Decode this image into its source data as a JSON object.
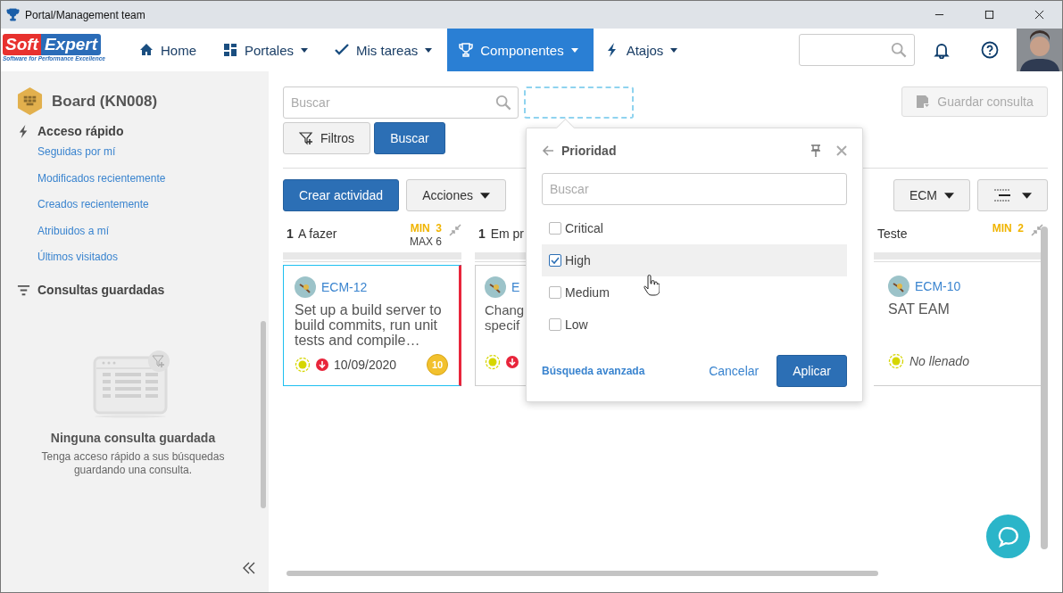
{
  "window": {
    "title": "Portal/Management team"
  },
  "nav": {
    "logo": {
      "word_1": "Soft",
      "word_2": "Expert",
      "tagline": "Software for Performance Excellence"
    },
    "items": [
      {
        "label": "Home",
        "dropdown": false,
        "selected": false
      },
      {
        "label": "Portales",
        "dropdown": true,
        "selected": false
      },
      {
        "label": "Mis tareas",
        "dropdown": true,
        "selected": false
      },
      {
        "label": "Componentes",
        "dropdown": true,
        "selected": true
      },
      {
        "label": "Atajos",
        "dropdown": true,
        "selected": false
      }
    ]
  },
  "sidebar": {
    "board_title": "Board (KN008)",
    "quick_access": {
      "title": "Acceso rápido",
      "links": [
        "Seguidas por mí",
        "Modificados recientemente",
        "Creados recientemente",
        "Atribuidos a mí",
        "Últimos visitados"
      ]
    },
    "saved_queries": {
      "title": "Consultas guardadas",
      "empty_title": "Ninguna consulta guardada",
      "empty_message": "Tenga acceso rápido a sus búsquedas guardando una consulta."
    }
  },
  "toolbar": {
    "search": {
      "placeholder": "Buscar"
    },
    "filters_button": "Filtros",
    "search_button": "Buscar",
    "save_button": {
      "label": "Guardar consulta",
      "disabled": true
    },
    "create_button": "Crear actividad",
    "actions_button": "Acciones",
    "type_button": "ECM"
  },
  "columns": [
    {
      "count": "1",
      "name": "A fazer",
      "min_label": "MIN",
      "min": "3",
      "max_label": "MAX",
      "max": "6",
      "cards": [
        {
          "id": "ECM-12",
          "title": "Set up a build server to build commits, run unit tests and compile…",
          "priority_down": true,
          "date": "10/09/2020",
          "date_filled": true,
          "badge": "10",
          "color": "#e8253b",
          "selected": true
        }
      ]
    },
    {
      "count": "1",
      "name": "Em pr",
      "cards": [
        {
          "id": "E",
          "title": "Chang\nspecif",
          "priority_down": true,
          "selected": false
        }
      ]
    },
    {
      "name": "Teste",
      "min_label": "MIN",
      "min": "2",
      "cards": [
        {
          "id": "ECM-10",
          "title": "SAT EAM",
          "priority_down": false,
          "date": "No llenado",
          "date_filled": false,
          "selected": false
        }
      ]
    }
  ],
  "filter_popup": {
    "title": "Prioridad",
    "search": {
      "placeholder": "Buscar"
    },
    "options": [
      {
        "label": "Critical",
        "checked": false,
        "selected": false
      },
      {
        "label": "High",
        "checked": true,
        "selected": true
      },
      {
        "label": "Medium",
        "checked": false,
        "selected": false
      },
      {
        "label": "Low",
        "checked": false,
        "selected": false
      }
    ],
    "advanced_link": "Búsqueda avanzada",
    "cancel_button": "Cancelar",
    "apply_button": "Aplicar"
  }
}
